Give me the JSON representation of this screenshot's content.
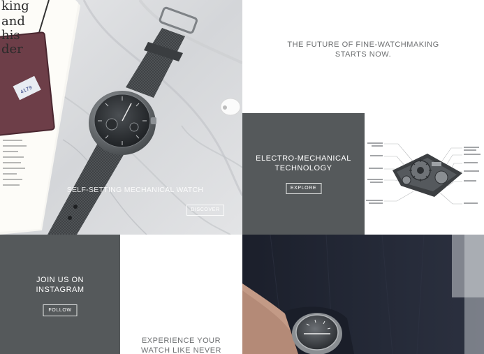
{
  "hero": {
    "title": "SELF-SETTING MECHANICAL WATCH",
    "button_label": "DISCOVER",
    "book_text": [
      "king",
      "and",
      "his",
      "der"
    ]
  },
  "tagline": {
    "line1": "THE FUTURE OF FINE-WATCHMAKING",
    "line2": "STARTS NOW."
  },
  "tech": {
    "line1": "ELECTRO-MECHANICAL",
    "line2": "TECHNOLOGY",
    "button_label": "EXPLORE"
  },
  "instagram": {
    "line1": "JOIN US ON",
    "line2": "INSTAGRAM",
    "button_label": "FOLLOW"
  },
  "experience": {
    "line1": "EXPERIENCE YOUR",
    "line2": "WATCH LIKE NEVER"
  },
  "colors": {
    "dark_panel": "#55595b",
    "text_gray": "#6d6f71",
    "white": "#ffffff"
  }
}
